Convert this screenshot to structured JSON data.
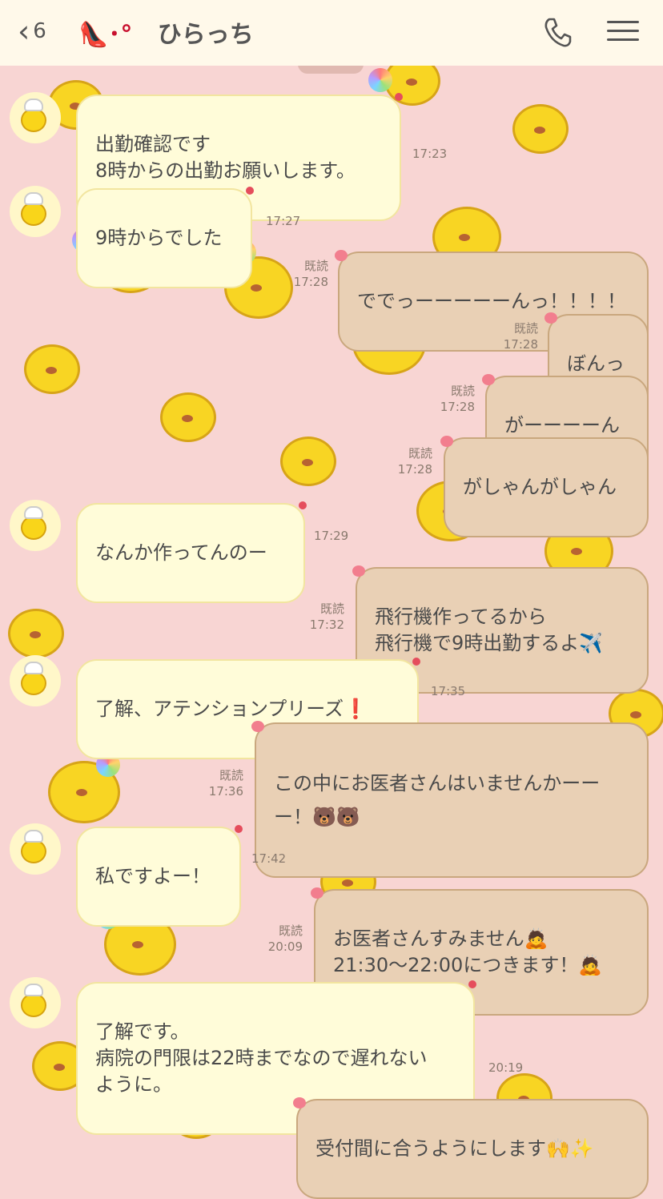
{
  "header": {
    "back_count": "6",
    "title_emoji": "👠･°",
    "title": "ひらっち"
  },
  "messages": [
    {
      "side": "in",
      "text": "出勤確認です\n8時からの出勤お願いします。",
      "time": "17:23"
    },
    {
      "side": "in",
      "text": "9時からでした",
      "time": "17:27"
    },
    {
      "side": "out",
      "text": "ででっーーーーーんっ！！！！",
      "read": "既読",
      "time": "17:28"
    },
    {
      "side": "out",
      "text": "ぼんっ",
      "read": "既読",
      "time": "17:28"
    },
    {
      "side": "out",
      "text": "がーーーーん",
      "read": "既読",
      "time": "17:28"
    },
    {
      "side": "out",
      "text": "がしゃんがしゃん",
      "read": "既読",
      "time": "17:28"
    },
    {
      "side": "in",
      "text": "なんか作ってんのー",
      "time": "17:29"
    },
    {
      "side": "out",
      "text": "飛行機作ってるから\n飛行機で9時出勤するよ✈️",
      "read": "既読",
      "time": "17:32"
    },
    {
      "side": "in",
      "text": "了解、アテンションプリーズ❗",
      "time": "17:35"
    },
    {
      "side": "out",
      "text": "この中にお医者さんはいませんかーー\nー！🐻🐻",
      "read": "既読",
      "time": "17:36"
    },
    {
      "side": "in",
      "text": "私ですよー！",
      "time": "17:42"
    },
    {
      "side": "out",
      "text": "お医者さんすみません🙇\n21:30〜22:00につきます！🙇",
      "read": "既読",
      "time": "20:09"
    },
    {
      "side": "in",
      "text": "了解です。\n病院の門限は22時までなので遅れない\nように。",
      "time": "20:19"
    },
    {
      "side": "out",
      "text": "受付間に合うようにします🙌✨",
      "read": "",
      "time": ""
    }
  ]
}
